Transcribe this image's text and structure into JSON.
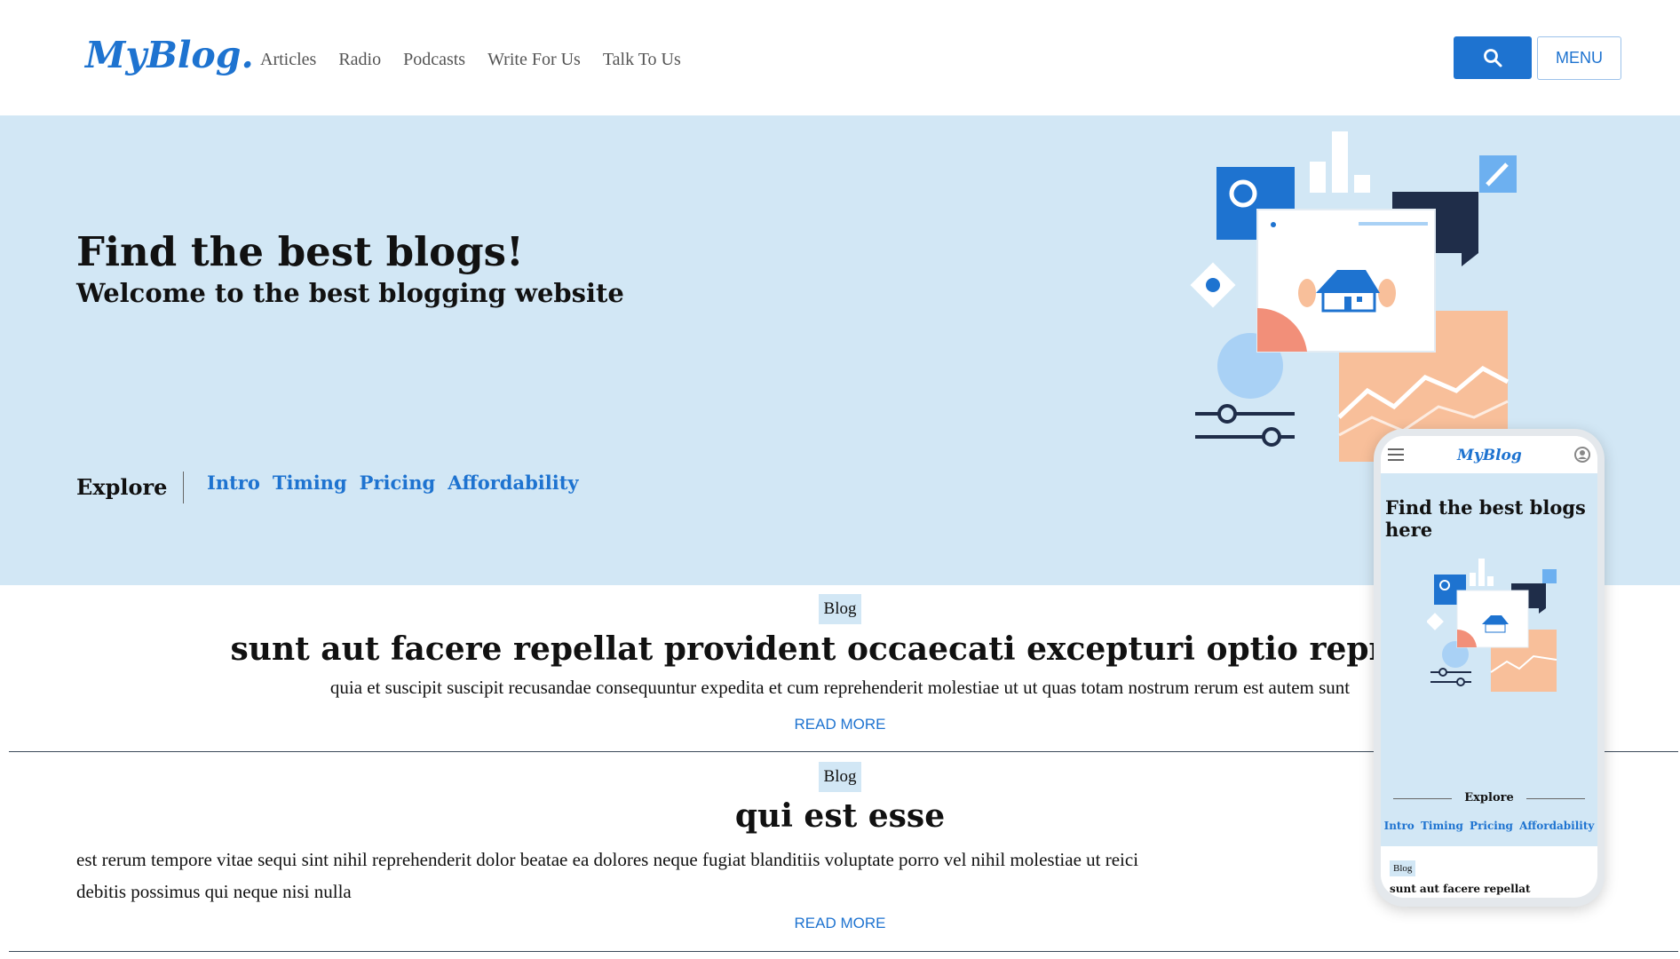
{
  "header": {
    "logo": "MyBlog.",
    "nav": [
      "Articles",
      "Radio",
      "Podcasts",
      "Write For Us",
      "Talk To Us"
    ],
    "search_icon": "search-icon",
    "menu_label": "MENU"
  },
  "hero": {
    "title": "Find the best blogs!",
    "subtitle": "Welcome to the best blogging website",
    "explore_label": "Explore",
    "explore_links": [
      "Intro",
      "Timing",
      "Pricing",
      "Affordability"
    ]
  },
  "posts": [
    {
      "badge": "Blog",
      "title": "sunt aut facere repellat provident occaecati excepturi optio reprehe",
      "body": "quia et suscipit suscipit recusandae consequuntur expedita et cum reprehenderit molestiae ut ut quas totam nostrum rerum est autem sunt",
      "read_more": "READ MORE"
    },
    {
      "badge": "Blog",
      "title": "qui est esse",
      "body_line1": "est rerum tempore vitae sequi sint nihil reprehenderit dolor beatae ea dolores neque fugiat blanditiis voluptate porro vel nihil molestiae ut reici",
      "body_line2": "debitis possimus qui neque nisi nulla",
      "read_more": "READ MORE"
    }
  ],
  "phone": {
    "logo": "MyBlog",
    "title": "Find the best blogs here",
    "explore_label": "Explore",
    "links": [
      "Intro",
      "Timing",
      "Pricing",
      "Affordability"
    ],
    "badge": "Blog",
    "post_title": "sunt aut facere repellat"
  },
  "colors": {
    "accent": "#1e73d0",
    "hero_bg": "#d2e7f5"
  }
}
